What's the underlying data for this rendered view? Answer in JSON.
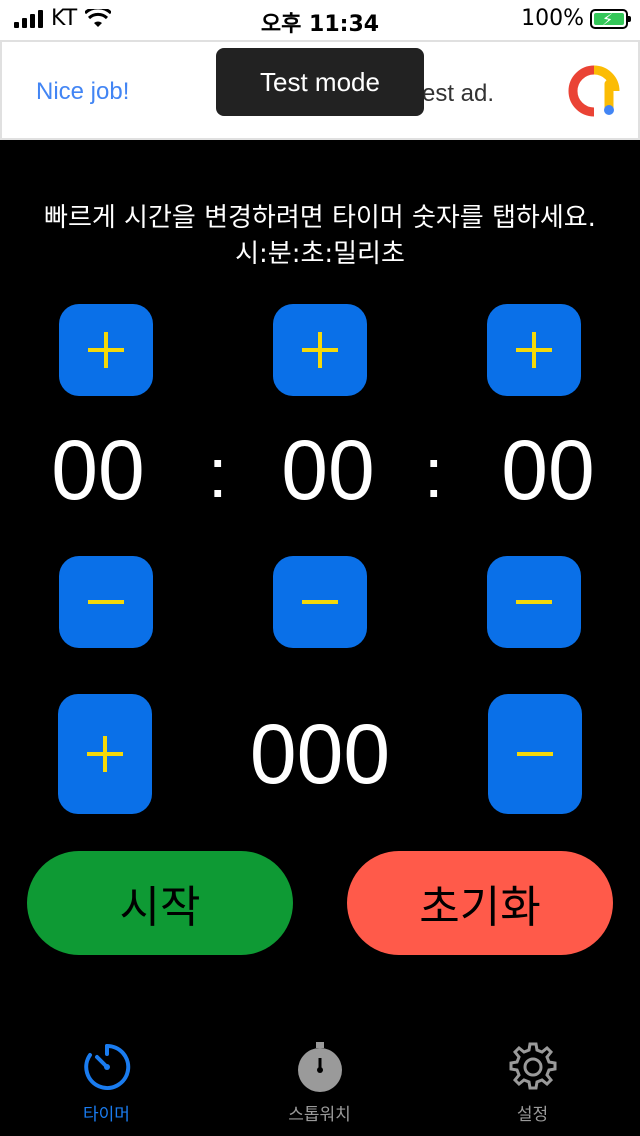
{
  "status_bar": {
    "carrier": "KT",
    "time": "오후 11:34",
    "battery": "100%"
  },
  "ad": {
    "left_text": "Nice job!",
    "right_text": "est ad.",
    "toast": "Test mode",
    "logo_icon": "google-ads-icon"
  },
  "hint": {
    "line1": "빠르게 시간을 변경하려면 타이머 숫자를 탭하세요.",
    "line2": "시:분:초:밀리초"
  },
  "timer": {
    "hours": "00",
    "minutes": "00",
    "seconds": "00",
    "millis": "000",
    "separator": ":"
  },
  "colors": {
    "button_blue": "#0a70e8",
    "symbol_yellow": "#f5d90a",
    "start_green": "#0e9a34",
    "reset_red": "#ff5a4a",
    "tab_active": "#1a7cf0",
    "tab_inactive": "#9a9a9a"
  },
  "actions": {
    "start": "시작",
    "reset": "초기화"
  },
  "tabs": [
    {
      "label": "타이머",
      "icon": "timer-icon",
      "active": true
    },
    {
      "label": "스톱워치",
      "icon": "stopwatch-icon",
      "active": false
    },
    {
      "label": "설정",
      "icon": "gear-icon",
      "active": false
    }
  ]
}
